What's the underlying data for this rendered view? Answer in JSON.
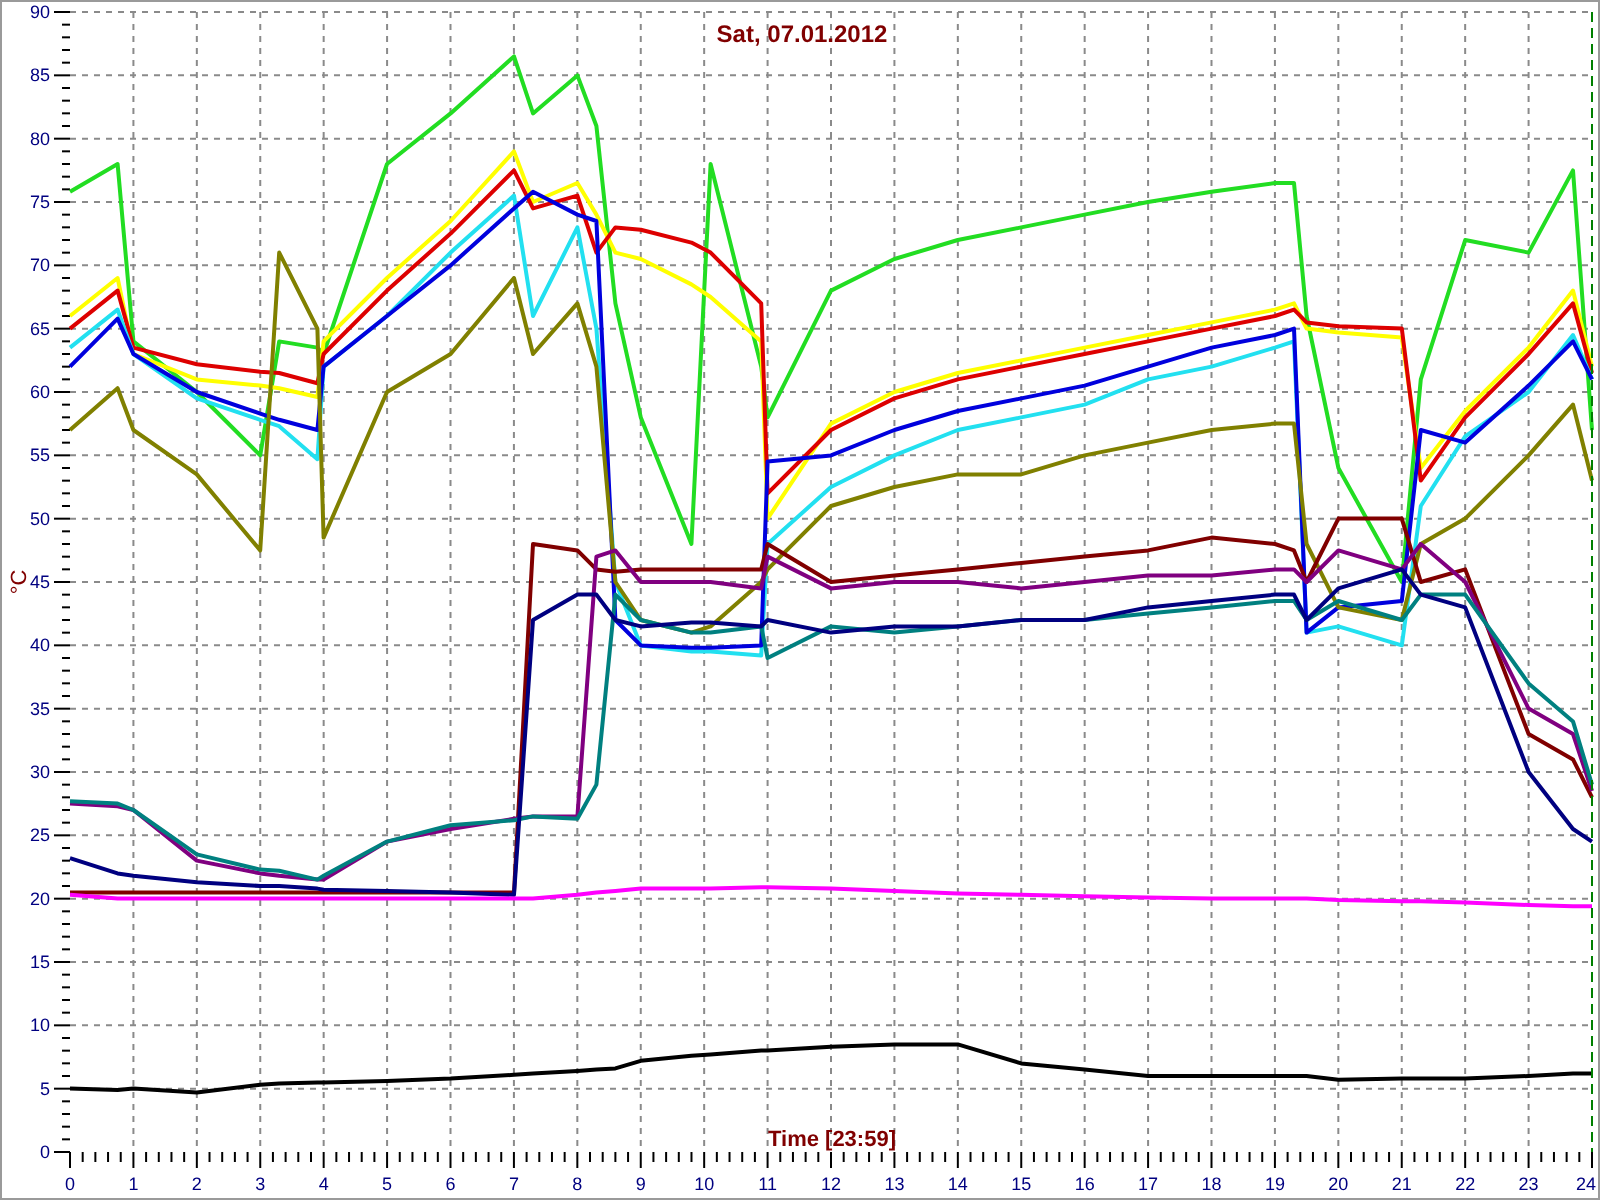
{
  "chart": {
    "chart_data": {
      "type": "line",
      "title": "Sat, 07.01.2012",
      "xlabel": "Time [23:59]",
      "ylabel": "°C",
      "grid": true,
      "xlim": [
        0,
        24
      ],
      "ylim": [
        0,
        90
      ],
      "xticks": [
        0,
        1,
        2,
        3,
        4,
        5,
        6,
        7,
        8,
        9,
        10,
        11,
        12,
        13,
        14,
        15,
        16,
        17,
        18,
        19,
        20,
        21,
        22,
        23,
        24
      ],
      "yticks": [
        0,
        5,
        10,
        15,
        20,
        25,
        30,
        35,
        40,
        45,
        50,
        55,
        60,
        65,
        70,
        75,
        80,
        85,
        90
      ],
      "x": [
        0,
        0.75,
        1,
        2,
        3,
        3.3,
        3.9,
        4,
        5,
        6,
        7,
        7.3,
        8,
        8.3,
        8.6,
        9,
        9.8,
        10.1,
        10.9,
        11,
        12,
        13,
        14,
        15,
        16,
        17,
        18,
        19,
        19.3,
        19.5,
        20,
        21,
        21.3,
        22,
        23,
        23.7,
        24
      ],
      "series": [
        {
          "color": "#22dd22",
          "values": [
            75.8,
            78,
            64,
            60,
            55,
            64,
            63.5,
            63,
            78,
            82,
            86.5,
            82,
            85,
            81,
            67,
            58,
            48,
            78,
            62,
            58,
            68,
            70.5,
            72,
            73,
            74,
            75,
            75.8,
            76.5,
            76.5,
            66,
            54,
            45,
            61,
            72,
            71,
            77.5,
            57
          ]
        },
        {
          "color": "#ffff00",
          "values": [
            66,
            69,
            63,
            61,
            60.5,
            60.3,
            59.6,
            64,
            69,
            73.5,
            79,
            75,
            76.5,
            74,
            71,
            70.5,
            68.5,
            67.5,
            64,
            50,
            57.5,
            60,
            61.5,
            62.5,
            63.5,
            64.5,
            65.5,
            66.5,
            67,
            65,
            64.7,
            64.3,
            54,
            58.5,
            63.5,
            68,
            62
          ]
        },
        {
          "color": "#dd0000",
          "values": [
            65,
            68,
            63.5,
            62.2,
            61.6,
            61.5,
            60.7,
            63,
            68,
            72.5,
            77.5,
            74.5,
            75.5,
            71,
            73,
            72.8,
            71.8,
            71,
            67,
            52,
            57,
            59.5,
            61,
            62,
            63,
            64,
            65,
            66,
            66.5,
            65.5,
            65.2,
            65,
            53,
            58,
            63,
            67,
            61.5
          ]
        },
        {
          "color": "#22e0f0",
          "values": [
            63.5,
            66.5,
            63,
            59.5,
            57.8,
            57.3,
            54.7,
            62,
            66,
            71,
            75.5,
            66,
            73,
            65,
            45,
            40,
            39.5,
            39.5,
            39.2,
            48,
            52.5,
            55,
            57,
            58,
            59,
            61,
            62,
            63.5,
            64,
            41,
            41.5,
            40,
            51,
            56.5,
            60,
            64.5,
            61
          ]
        },
        {
          "color": "#0000dd",
          "values": [
            62,
            65.8,
            63,
            60,
            58.3,
            57.8,
            57,
            62,
            66,
            70,
            74.5,
            75.8,
            74,
            73.5,
            42,
            40,
            39.8,
            39.8,
            40,
            54.5,
            55,
            57,
            58.5,
            59.5,
            60.5,
            62,
            63.5,
            64.5,
            65,
            41,
            43,
            43.5,
            57,
            56,
            60.5,
            64,
            61
          ]
        },
        {
          "color": "#808000",
          "values": [
            57,
            60.3,
            57,
            53.5,
            47.5,
            71,
            65,
            48.5,
            60,
            63,
            69,
            63,
            67,
            62,
            45,
            42,
            41,
            41.5,
            45,
            46,
            51,
            52.5,
            53.5,
            53.5,
            55,
            56,
            57,
            57.5,
            57.5,
            48,
            43,
            42,
            48,
            50,
            55,
            59,
            53
          ]
        },
        {
          "color": "#800000",
          "values": [
            20.5,
            20.5,
            20.5,
            20.5,
            20.5,
            20.5,
            20.5,
            20.5,
            20.5,
            20.5,
            20.5,
            48,
            47.5,
            46,
            45.8,
            46,
            46,
            46,
            46,
            48,
            45,
            45.5,
            46,
            46.5,
            47,
            47.5,
            48.5,
            48,
            47.5,
            45,
            50,
            50,
            45,
            46,
            33,
            31,
            28
          ]
        },
        {
          "color": "#800080",
          "values": [
            27.5,
            27.3,
            27,
            23,
            22,
            21.8,
            21.5,
            21.5,
            24.5,
            25.5,
            26.3,
            26.5,
            26.5,
            47,
            47.5,
            45,
            45,
            45,
            44.5,
            47,
            44.5,
            45,
            45,
            44.5,
            45,
            45.5,
            45.5,
            46,
            46,
            45,
            47.5,
            46,
            48,
            45,
            35,
            33,
            28.5
          ]
        },
        {
          "color": "#008080",
          "values": [
            27.7,
            27.5,
            27,
            23.5,
            22.3,
            22.2,
            21.5,
            21.8,
            24.5,
            25.8,
            26.2,
            26.5,
            26.3,
            29,
            44,
            42,
            41,
            41,
            41.5,
            39,
            41.5,
            41,
            41.5,
            42,
            42,
            42.5,
            43,
            43.5,
            43.5,
            42,
            43.5,
            42,
            44,
            44,
            37,
            34,
            29
          ]
        },
        {
          "color": "#000080",
          "values": [
            23.2,
            22,
            21.8,
            21.3,
            21,
            21,
            20.8,
            20.7,
            20.6,
            20.5,
            20.3,
            42,
            44,
            44,
            42,
            41.5,
            41.8,
            41.8,
            41.5,
            42,
            41,
            41.5,
            41.5,
            42,
            42,
            43,
            43.5,
            44,
            44,
            42,
            44.5,
            46,
            44,
            43,
            30,
            25.5,
            24.5
          ]
        },
        {
          "color": "#ff00ff",
          "values": [
            20.3,
            20,
            20,
            20,
            20,
            20,
            20,
            20,
            20,
            20,
            20,
            20,
            20.3,
            20.5,
            20.6,
            20.8,
            20.8,
            20.8,
            20.9,
            20.9,
            20.8,
            20.6,
            20.4,
            20.3,
            20.2,
            20.1,
            20,
            20,
            20,
            20,
            19.9,
            19.8,
            19.8,
            19.7,
            19.5,
            19.4,
            19.4
          ]
        },
        {
          "color": "#000000",
          "values": [
            5,
            4.9,
            5,
            4.7,
            5.3,
            5.4,
            5.5,
            5.5,
            5.6,
            5.8,
            6.1,
            6.2,
            6.4,
            6.5,
            6.6,
            7.2,
            7.6,
            7.7,
            8,
            8,
            8.3,
            8.5,
            8.5,
            7,
            6.5,
            6,
            6,
            6,
            6,
            6,
            5.7,
            5.8,
            5.8,
            5.8,
            6,
            6.2,
            6.2
          ]
        }
      ]
    }
  }
}
